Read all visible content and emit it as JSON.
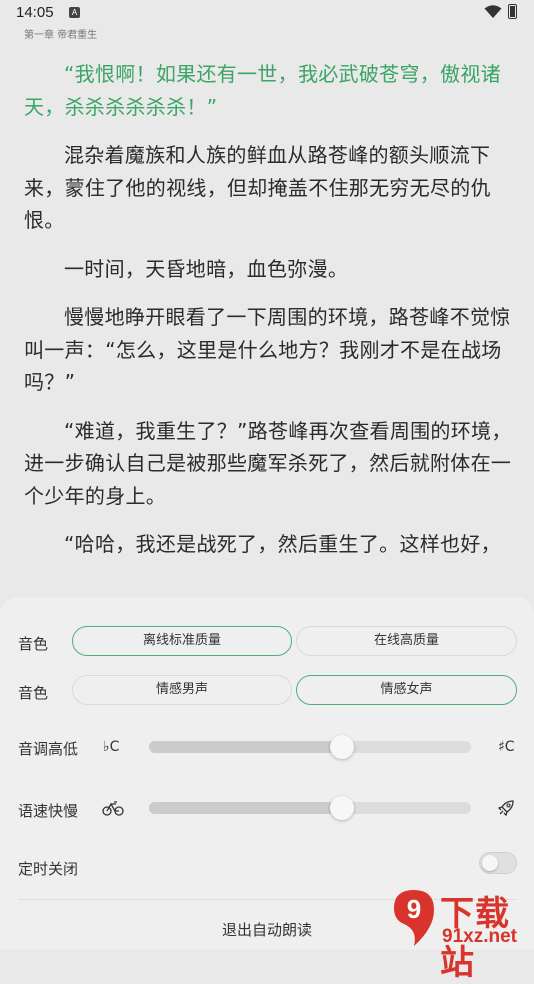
{
  "status": {
    "time": "14:05",
    "notif_glyph": "A"
  },
  "chapter_title": "第一章 帝君重生",
  "paragraphs": [
    {
      "text": "“我恨啊！如果还有一世，我必武破苍穹，傲视诸天，杀杀杀杀杀杀！”",
      "highlighted": true
    },
    {
      "text": "混杂着魔族和人族的鲜血从路苍峰的额头顺流下来，蒙住了他的视线，但却掩盖不住那无穷无尽的仇恨。",
      "highlighted": false
    },
    {
      "text": "一时间，天昏地暗，血色弥漫。",
      "highlighted": false
    },
    {
      "text": "慢慢地睁开眼看了一下周围的环境，路苍峰不觉惊叫一声：“怎么，这里是什么地方？我刚才不是在战场吗？”",
      "highlighted": false
    },
    {
      "text": "“难道，我重生了？”路苍峰再次查看周围的环境，进一步确认自己是被那些魔军杀死了，然后就附体在一个少年的身上。",
      "highlighted": false
    },
    {
      "text": "“哈哈，我还是战死了，然后重生了。这样也好，",
      "highlighted": false
    }
  ],
  "panel": {
    "voice_quality_label": "音色",
    "voice_quality_options": [
      "离线标准质量",
      "在线高质量"
    ],
    "voice_quality_selected": 0,
    "voice_type_label": "音色",
    "voice_type_options": [
      "情感男声",
      "情感女声"
    ],
    "voice_type_selected": 1,
    "pitch_label": "音调高低",
    "pitch_low_glyph": "♭C",
    "pitch_high_glyph": "♯C",
    "pitch_value": 0.6,
    "speed_label": "语速快慢",
    "speed_low_icon": "bicycle-icon",
    "speed_high_icon": "rocket-icon",
    "speed_value": 0.6,
    "timer_label": "定时关闭",
    "timer_on": false,
    "exit_label": "退出自动朗读"
  },
  "watermark": {
    "title": "下载站",
    "url": "91xz.net",
    "logo_glyph": "9"
  },
  "colors": {
    "accent": "#3aa564",
    "brand_red": "#d9342b"
  }
}
